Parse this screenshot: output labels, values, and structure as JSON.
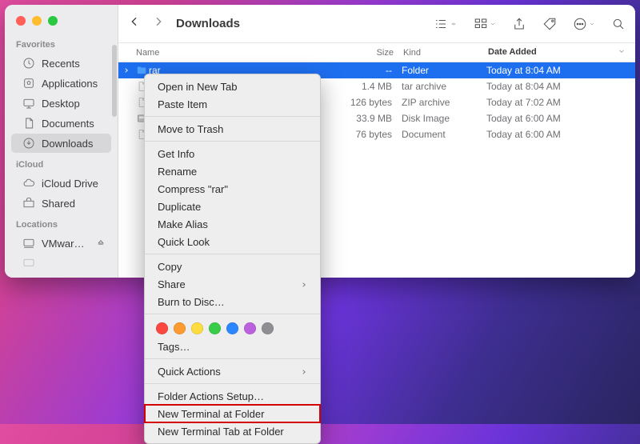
{
  "window": {
    "title": "Downloads"
  },
  "sidebar": {
    "sections": {
      "favorites": "Favorites",
      "icloud": "iCloud",
      "locations": "Locations"
    },
    "items": {
      "recents": "Recents",
      "applications": "Applications",
      "desktop": "Desktop",
      "documents": "Documents",
      "downloads": "Downloads",
      "icloud_drive": "iCloud Drive",
      "shared": "Shared",
      "vmware": "VMwar…"
    }
  },
  "columns": {
    "name": "Name",
    "size": "Size",
    "kind": "Kind",
    "date": "Date Added"
  },
  "file_hidden_prefix": "rar",
  "files": [
    {
      "name": "rar",
      "size": "--",
      "kind": "Folder",
      "date": "Today at 8:04 AM",
      "type": "folder",
      "selected": true
    },
    {
      "name": "",
      "size": "1.4 MB",
      "kind": "tar archive",
      "date": "Today at 8:04 AM",
      "type": "file"
    },
    {
      "name": "",
      "size": "126 bytes",
      "kind": "ZIP archive",
      "date": "Today at 7:02 AM",
      "type": "file"
    },
    {
      "name": "",
      "size": "33.9 MB",
      "kind": "Disk Image",
      "date": "Today at 6:00 AM",
      "type": "dmg"
    },
    {
      "name": "",
      "size": "76 bytes",
      "kind": "Document",
      "date": "Today at 6:00 AM",
      "type": "doc"
    }
  ],
  "context_menu": {
    "open_new_tab": "Open in New Tab",
    "paste_item": "Paste Item",
    "move_to_trash": "Move to Trash",
    "get_info": "Get Info",
    "rename": "Rename",
    "compress": "Compress \"rar\"",
    "duplicate": "Duplicate",
    "make_alias": "Make Alias",
    "quick_look": "Quick Look",
    "copy": "Copy",
    "share": "Share",
    "burn": "Burn to Disc…",
    "tags": "Tags…",
    "quick_actions": "Quick Actions",
    "folder_actions": "Folder Actions Setup…",
    "new_terminal": "New Terminal at Folder",
    "new_terminal_tab": "New Terminal Tab at Folder"
  },
  "tag_colors": [
    "#fc4741",
    "#fd9a30",
    "#fddc40",
    "#38cc48",
    "#2c86ff",
    "#bb61de",
    "#8e8e93"
  ]
}
